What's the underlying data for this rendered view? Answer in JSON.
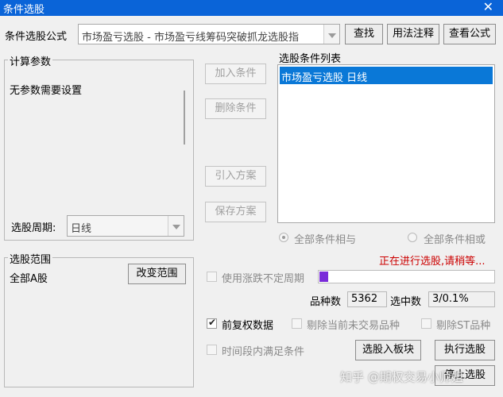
{
  "window": {
    "title": "条件选股",
    "close_glyph": "✕"
  },
  "formula": {
    "label": "条件选股公式",
    "value": "市场盈亏选股  -  市场盈亏线筹码突破抓龙选股指",
    "find_button": "查找",
    "usage_button": "用法注释",
    "view_button": "查看公式"
  },
  "params": {
    "group_label": "计算参数",
    "message": "无参数需要设置",
    "period_label": "选股周期:",
    "period_value": "日线"
  },
  "actions": {
    "add": "加入条件",
    "delete": "删除条件",
    "import": "引入方案",
    "save": "保存方案"
  },
  "conditions": {
    "label": "选股条件列表",
    "items": [
      "市场盈亏选股  日线"
    ],
    "selected_color": "#0a78d7"
  },
  "logic": {
    "and_label": "全部条件相与",
    "or_label": "全部条件相或",
    "selected": "and"
  },
  "status": {
    "text": "正在进行选股,请稍等...",
    "color": "#cc0000"
  },
  "range": {
    "group_label": "选股范围",
    "value": "全部A股",
    "change_button": "改变范围"
  },
  "progress": {
    "uncertain_period_label": "使用涨跌不定周期",
    "fraction": 0.05,
    "fill_color": "#7a2bd9"
  },
  "counts": {
    "total_label": "品种数",
    "total_value": "5362",
    "selected_label": "选中数",
    "selected_value": "3/0.1%"
  },
  "options": {
    "adjusted": {
      "label": "前复权数据",
      "checked": true
    },
    "exclude_untraded": {
      "label": "剔除当前未交易品种",
      "checked": false
    },
    "exclude_st": {
      "label": "剔除ST品种",
      "checked": false
    },
    "time_range": {
      "label": "时间段内满足条件",
      "checked": false
    }
  },
  "bottom": {
    "to_block": "选股入板块",
    "execute": "执行选股",
    "stop": "停止选股"
  },
  "watermark": "知乎 @期权交易小师姐"
}
